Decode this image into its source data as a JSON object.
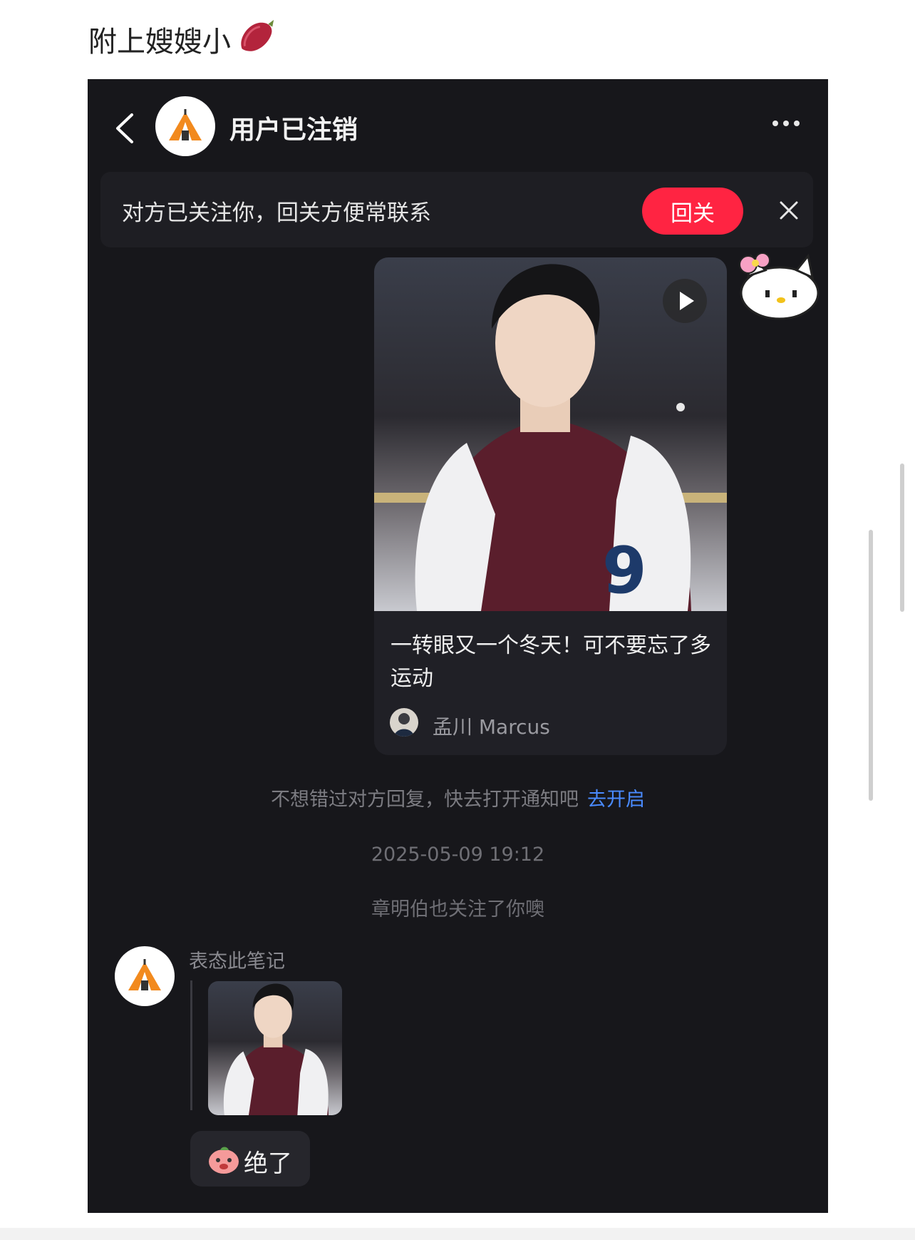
{
  "caption": {
    "text": "附上嫂嫂小"
  },
  "chat": {
    "header": {
      "title": "用户已注销"
    },
    "banner": {
      "text": "对方已关注你，回关方便常联系",
      "button": "回关"
    },
    "note": {
      "title": "一转眼又一个冬天！可不要忘了多运动",
      "author": "孟川 Marcus"
    },
    "notify": {
      "text": "不想错过对方回复，快去打开通知吧",
      "link": "去开启"
    },
    "timestamp": "2025-05-09 19:12",
    "also_followed": "章明伯也关注了你噢",
    "message": {
      "react_label": "表态此笔记",
      "reply": "绝了"
    }
  },
  "colors": {
    "background": "#17171b",
    "accent": "#ff2442",
    "link": "#4a8bff"
  },
  "icons": [
    "back-arrow-icon",
    "tent-icon",
    "more-dots-icon",
    "close-icon",
    "play-icon",
    "sweet-potato-icon",
    "peach-emoji-icon",
    "hello-kitty-sticker"
  ]
}
